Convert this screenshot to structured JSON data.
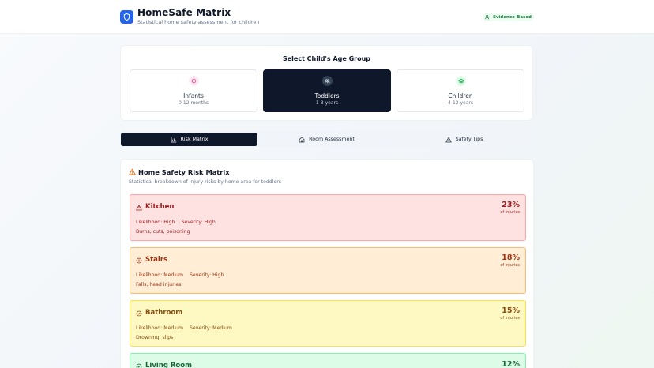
{
  "header": {
    "title": "HomeSafe Matrix",
    "subtitle": "Statistical home safety assessment for children",
    "badge": "Evidence-Based",
    "brand_color": "#2563eb"
  },
  "age_selector": {
    "title": "Select Child's Age Group",
    "options": [
      {
        "name": "Infants",
        "range": "0-12 months",
        "icon": "baby-icon",
        "selected": false
      },
      {
        "name": "Toddlers",
        "range": "1-3 years",
        "icon": "users-icon",
        "selected": true
      },
      {
        "name": "Children",
        "range": "4-12 years",
        "icon": "graduation-cap-icon",
        "selected": false
      }
    ]
  },
  "tabs": [
    {
      "label": "Risk Matrix",
      "icon": "bar-chart-icon",
      "active": true
    },
    {
      "label": "Room Assessment",
      "icon": "home-icon",
      "active": false
    },
    {
      "label": "Safety Tips",
      "icon": "warning-icon",
      "active": false
    }
  ],
  "matrix": {
    "title": "Home Safety Risk Matrix",
    "description": "Statistical breakdown of injury risks by home area for toddlers",
    "areas": [
      {
        "name": "Kitchen",
        "icon": "warning-icon",
        "likelihood": "Likelihood: High",
        "severity": "Severity: High",
        "injuries": "Burns, cuts, poisoning",
        "percent": "23%",
        "percent_label": "of injuries"
      },
      {
        "name": "Stairs",
        "icon": "alert-circle-icon",
        "likelihood": "Likelihood: Medium",
        "severity": "Severity: High",
        "injuries": "Falls, head injuries",
        "percent": "18%",
        "percent_label": "of injuries"
      },
      {
        "name": "Bathroom",
        "icon": "check-circle-icon",
        "likelihood": "Likelihood: Medium",
        "severity": "Severity: Medium",
        "injuries": "Drowning, slips",
        "percent": "15%",
        "percent_label": "of injuries"
      },
      {
        "name": "Living Room",
        "icon": "check-circle-icon",
        "percent": "12%"
      }
    ]
  }
}
